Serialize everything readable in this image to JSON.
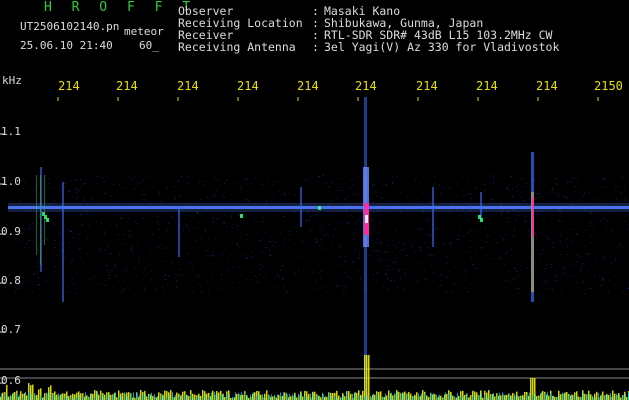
{
  "header": {
    "brand": "H R O F F T",
    "filename": "UT2506102140.pn",
    "tag": "meteor",
    "datetime": "25.06.10 21:40",
    "value": "60_"
  },
  "meta": [
    {
      "key": "Observer",
      "sep": ":",
      "value": "Masaki Kano"
    },
    {
      "key": "Receiving Location",
      "sep": ":",
      "value": "Shibukawa, Gunma, Japan"
    },
    {
      "key": "Receiver",
      "sep": ":",
      "value": "RTL-SDR SDR# 43dB L15 103.2MHz CW"
    },
    {
      "key": "Receiving Antenna",
      "sep": ":",
      "value": "3el Yagi(V) Az 330 for Vladivostok"
    }
  ],
  "y_axis_unit": "kHz",
  "x_ticks": [
    "214",
    "214",
    "214",
    "214",
    "214",
    "214",
    "214",
    "214",
    "214",
    "2150"
  ],
  "y_ticks": [
    "1.1",
    "1.0",
    "0.9",
    "0.8",
    "0.7",
    "0.6"
  ],
  "colors": {
    "background": "#000000",
    "tick_x": "#e8e000",
    "header_text": "#dcdcdc",
    "brand": "#2ecc40",
    "carrier_band": "#4f7bff",
    "meteor_hot": "#ff2aa0",
    "amplitude_bars": "#f0f000",
    "noise_floor": "#00d0ff"
  }
}
